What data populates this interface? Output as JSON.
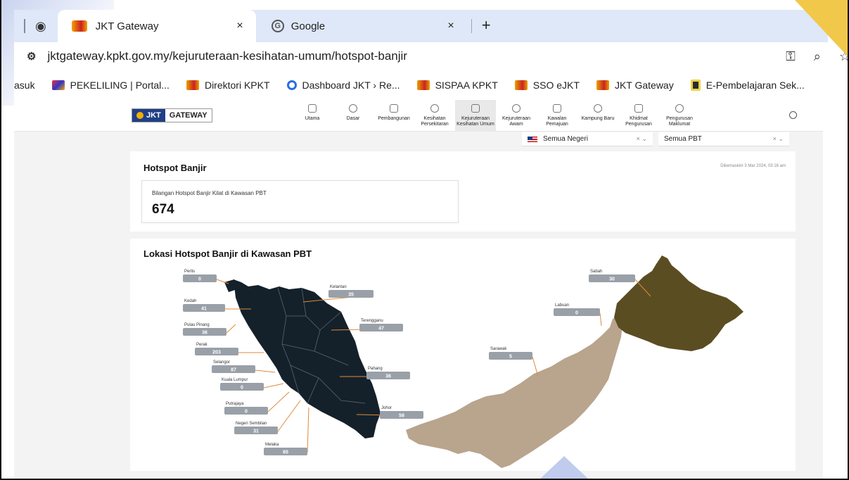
{
  "browser": {
    "tabs": [
      {
        "title": "JKT Gateway",
        "active": true
      },
      {
        "title": "Google",
        "active": false
      }
    ],
    "new_tab_label": "+",
    "close_glyph": "×",
    "url": "jktgateway.kpkt.gov.my/kejuruteraan-kesihatan-umum/hotspot-banjir",
    "bookmarks": [
      {
        "label": "asuk",
        "icon": "none"
      },
      {
        "label": "PEKELILING | Portal...",
        "icon": "star"
      },
      {
        "label": "Direktori KPKT",
        "icon": "emb"
      },
      {
        "label": "Dashboard JKT › Re...",
        "icon": "dash"
      },
      {
        "label": "SISPAA KPKT",
        "icon": "emb"
      },
      {
        "label": "SSO eJKT",
        "icon": "emb"
      },
      {
        "label": "JKT Gateway",
        "icon": "emb"
      },
      {
        "label": "E-Pembelajaran Sek...",
        "icon": "dark"
      }
    ]
  },
  "app": {
    "logo": {
      "part1": "JKT",
      "part2": "GATEWAY"
    },
    "menu": [
      {
        "label": "Utama",
        "active": false
      },
      {
        "label": "Dasar",
        "active": false
      },
      {
        "label": "Pembangunan",
        "active": false
      },
      {
        "label": "Kesihatan Persekitaran",
        "active": false
      },
      {
        "label": "Kejuruteraan Kesihatan Umum",
        "active": true
      },
      {
        "label": "Kejuruteraan Awam",
        "active": false
      },
      {
        "label": "Kawalan Pemajuan",
        "active": false
      },
      {
        "label": "Kampung Baru",
        "active": false
      },
      {
        "label": "Khidmat Pengurusan",
        "active": false
      },
      {
        "label": "Pengurusan Maklumat",
        "active": false
      }
    ],
    "filters": {
      "negeri": "Semua Negeri",
      "pbt": "Semua PBT",
      "clear": "×",
      "caret": "⌄"
    },
    "hotspot": {
      "title": "Hotspot Banjir",
      "updated": "Dikemaskini 3 Mar 2024, 03:16 am",
      "stat_label": "Bilangan Hotspot Banjir Kilat di Kawasan PBT",
      "stat_value": "674"
    },
    "map": {
      "title": "Lokasi Hotspot Banjir di Kawasan PBT",
      "colors": {
        "peninsular": "#14212b",
        "sarawak": "#b9a48d",
        "sabah": "#5b4d22",
        "label_bg": "#9aa0a8",
        "leader": "#e08a3a"
      },
      "states": [
        {
          "name": "Perlis",
          "value": "0"
        },
        {
          "name": "Kedah",
          "value": "41"
        },
        {
          "name": "Pulau Pinang",
          "value": "36"
        },
        {
          "name": "Perak",
          "value": "203"
        },
        {
          "name": "Selangor",
          "value": "87"
        },
        {
          "name": "Kuala Lumpur",
          "value": "0"
        },
        {
          "name": "Putrajaya",
          "value": "0"
        },
        {
          "name": "Negeri Sembilan",
          "value": "31"
        },
        {
          "name": "Melaka",
          "value": "65"
        },
        {
          "name": "Kelantan",
          "value": "35"
        },
        {
          "name": "Terengganu",
          "value": "47"
        },
        {
          "name": "Pahang",
          "value": "36"
        },
        {
          "name": "Johor",
          "value": "58"
        },
        {
          "name": "Sarawak",
          "value": "5"
        },
        {
          "name": "Labuan",
          "value": "0"
        },
        {
          "name": "Sabah",
          "value": "30"
        }
      ]
    }
  }
}
